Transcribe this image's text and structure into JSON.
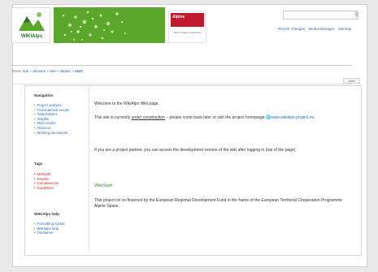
{
  "header": {
    "logo_text": "WIKIAlps",
    "alpine_logo_title": "Alpine",
    "alpine_logo_subtitle": "Alpine Space programme",
    "search_placeholder": "",
    "links": [
      "Recent changes",
      "Media Manager",
      "Sitemap"
    ]
  },
  "trace": {
    "label": "Trace: ",
    "crumbs": [
      "sub",
      "aboutus",
      "wiki",
      "itaplan"
    ],
    "current": "start"
  },
  "tab_label": "start",
  "sidebar": {
    "navigation": {
      "heading": "Navigation",
      "items": [
        "Project analysis",
        "Transnational results",
        "Stakeholders",
        "Insights",
        "Main results",
        "About us",
        "Working documents"
      ]
    },
    "tags": {
      "heading": "Tags",
      "items": [
        "Methods",
        "Results",
        "Competences",
        "Guidelines"
      ]
    },
    "help": {
      "heading": "WIKIAlps help",
      "items": [
        "Formatting syntax",
        "WIKIalps help",
        "Disclaimer"
      ]
    }
  },
  "main": {
    "welcome": "Welcome to the WikiAlps Wiki page.",
    "construction_pre": "This site is currently ",
    "construction_link": "under construction",
    "construction_mid": ". - please come back later or visit the project homepage ",
    "homepage_link": "www.wikialps-project.eu",
    "partner_note": "If you are a project partner, you can access the development version of the wiki after logging in (top of the page).",
    "wikistart": "WikiStart",
    "cofinance": "This project ist co-financed by the European Regional Development Fund in the frame of the European Territorial Cooperation Programme Alpine Space."
  }
}
